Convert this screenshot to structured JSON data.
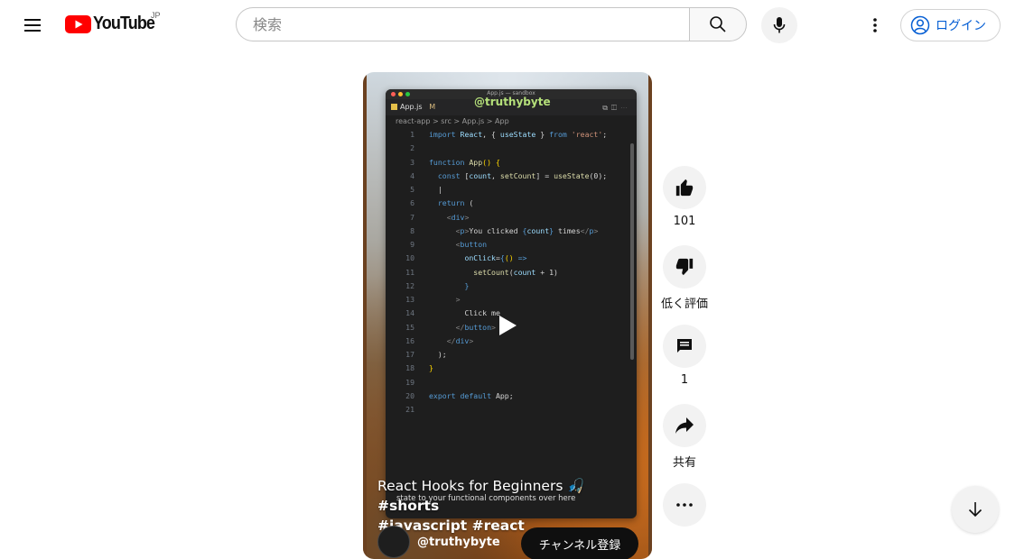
{
  "header": {
    "logo_text": "YouTube",
    "region": "JP",
    "search_placeholder": "検索",
    "login_label": "ログイン"
  },
  "player": {
    "editor": {
      "window_title": "App.js — sandbox",
      "tab_label": "App.js",
      "tab_modified": "M",
      "watermark": "@truthybyte",
      "breadcrumb": "react-app > src > App.js > App",
      "lines": [
        {
          "n": "1",
          "html": "<span class='k'>import</span> <span class='v'>React</span><span class='w'>, { </span><span class='v'>useState</span><span class='w'> } </span><span class='k'>from</span> <span class='s'>'react'</span><span class='w'>;</span>"
        },
        {
          "n": "2",
          "html": ""
        },
        {
          "n": "3",
          "html": "<span class='k'>function</span> <span class='f'>App</span><span class='y'>()</span> <span class='y'>{</span>"
        },
        {
          "n": "4",
          "html": "  <span class='k'>const</span> <span class='w'>[</span><span class='v'>count</span><span class='w'>, </span><span class='f'>setCount</span><span class='w'>] = </span><span class='f'>useState</span><span class='w'>(0);</span>"
        },
        {
          "n": "5",
          "html": "  <span class='w'>|</span>"
        },
        {
          "n": "6",
          "html": "  <span class='k'>return</span> <span class='w'>(</span>"
        },
        {
          "n": "7",
          "html": "    <span class='t'>&lt;</span><span class='g'>div</span><span class='t'>&gt;</span>"
        },
        {
          "n": "8",
          "html": "      <span class='t'>&lt;</span><span class='g'>p</span><span class='t'>&gt;</span><span class='w'>You clicked </span><span class='g'>{</span><span class='v'>count</span><span class='g'>}</span><span class='w'> times</span><span class='t'>&lt;/</span><span class='g'>p</span><span class='t'>&gt;</span>"
        },
        {
          "n": "9",
          "html": "      <span class='t'>&lt;</span><span class='g'>button</span>"
        },
        {
          "n": "10",
          "html": "        <span class='v'>onClick</span><span class='w'>=</span><span class='g'>{</span><span class='y'>()</span> <span class='k'>=&gt;</span>"
        },
        {
          "n": "11",
          "html": "          <span class='f'>setCount</span><span class='w'>(</span><span class='v'>count</span><span class='w'> + 1)</span>"
        },
        {
          "n": "12",
          "html": "        <span class='g'>}</span>"
        },
        {
          "n": "13",
          "html": "      <span class='t'>&gt;</span>"
        },
        {
          "n": "14",
          "html": "        <span class='w'>Click me</span>"
        },
        {
          "n": "15",
          "html": "      <span class='t'>&lt;/</span><span class='g'>button</span><span class='t'>&gt;</span>"
        },
        {
          "n": "16",
          "html": "    <span class='t'>&lt;/</span><span class='g'>div</span><span class='t'>&gt;</span>"
        },
        {
          "n": "17",
          "html": "  <span class='w'>);</span>"
        },
        {
          "n": "18",
          "html": "<span class='y'>}</span>"
        },
        {
          "n": "19",
          "html": ""
        },
        {
          "n": "20",
          "html": "<span class='k'>export default</span> <span class='w'>App;</span>"
        },
        {
          "n": "21",
          "html": ""
        }
      ]
    },
    "title_text": "React Hooks for Beginners 🎣",
    "title_tags_1": "#shorts",
    "title_tags_2": "#javascript #react",
    "subtitle_overlay": "state to your functional components over here",
    "channel_name": "@truthybyte",
    "subscribe_label": "チャンネル登録"
  },
  "actions": {
    "like_count": "101",
    "dislike_label": "低く評価",
    "comment_count": "1",
    "share_label": "共有"
  },
  "colors": {
    "brand_red": "#ff0000",
    "link_blue": "#065fd4",
    "button_bg": "#f2f2f2"
  }
}
